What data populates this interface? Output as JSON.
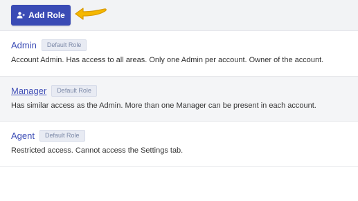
{
  "toolbar": {
    "add_role_label": "Add Role"
  },
  "icons": {
    "add_role": "add-user-icon",
    "pointer": "arrow-pointer-icon"
  },
  "colors": {
    "primary": "#3a4bb5",
    "arrow": "#f5b800"
  },
  "roles": [
    {
      "name": "Admin",
      "badge": "Default Role",
      "description": "Account Admin. Has access to all areas. Only one Admin per account. Owner of the account."
    },
    {
      "name": "Manager",
      "badge": "Default Role",
      "description": "Has similar access as the Admin. More than one Manager can be present in each account."
    },
    {
      "name": "Agent",
      "badge": "Default Role",
      "description": "Restricted access. Cannot access the Settings tab."
    }
  ]
}
